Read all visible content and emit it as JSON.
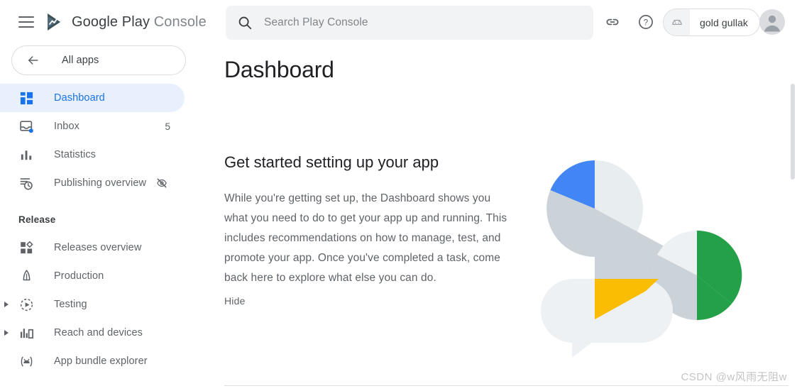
{
  "topbar": {
    "menu_icon": "hamburger-menu-icon",
    "logo_icon": "google-play-console-logo",
    "brand_primary": "Google Play",
    "brand_secondary": "Console",
    "search": {
      "icon": "search-icon",
      "placeholder": "Search Play Console",
      "value": ""
    },
    "link_icon": "link-icon",
    "help_icon": "help-circle-icon",
    "account_chip": {
      "icon": "android-robot-icon",
      "label": "gold gullak"
    },
    "avatar": "user-avatar-icon"
  },
  "sidebar": {
    "all_apps": {
      "icon": "arrow-left-icon",
      "label": "All apps"
    },
    "items": [
      {
        "label": "Dashboard",
        "icon": "dashboard-grid-icon",
        "active": true,
        "badge": "",
        "trailing": "",
        "expandable": false
      },
      {
        "label": "Inbox",
        "icon": "inbox-icon",
        "active": false,
        "badge": "5",
        "trailing": "",
        "expandable": false
      },
      {
        "label": "Statistics",
        "icon": "bar-chart-icon",
        "active": false,
        "badge": "",
        "trailing": "",
        "expandable": false
      },
      {
        "label": "Publishing overview",
        "icon": "publishing-clock-icon",
        "active": false,
        "badge": "",
        "trailing": "visibility-off-icon",
        "expandable": false
      }
    ],
    "section_release": "Release",
    "release_items": [
      {
        "label": "Releases overview",
        "icon": "releases-overview-icon",
        "expandable": false
      },
      {
        "label": "Production",
        "icon": "rocket-icon",
        "expandable": false
      },
      {
        "label": "Testing",
        "icon": "testing-play-dashed-icon",
        "expandable": true
      },
      {
        "label": "Reach and devices",
        "icon": "reach-devices-icon",
        "expandable": true
      },
      {
        "label": "App bundle explorer",
        "icon": "app-bundle-android-icon",
        "expandable": false
      }
    ]
  },
  "main": {
    "page_title": "Dashboard",
    "promo_heading": "Get started setting up your app",
    "promo_body": "While you're getting set up, the Dashboard shows you what you need to do to get your app up and running. This includes recommendations on how to manage, test, and promote your app. Once you've completed a task, come back here to explore what else you can do.",
    "hide_label": "Hide",
    "illustration": "play-console-abstract-shapes-illustration"
  },
  "watermark": "CSDN @w风雨无阻w",
  "colors": {
    "accent_blue": "#1a73e8",
    "active_pill": "#e8f0fe",
    "text_primary": "#202124",
    "text_secondary": "#5f6368",
    "illus_blue": "#4285f4",
    "illus_green": "#24a148",
    "illus_yellow": "#fbbc04",
    "illus_grey_dark": "#ccd3d8",
    "illus_grey_light": "#e8edef",
    "search_bg": "#f1f3f4",
    "border": "#dadce0"
  }
}
